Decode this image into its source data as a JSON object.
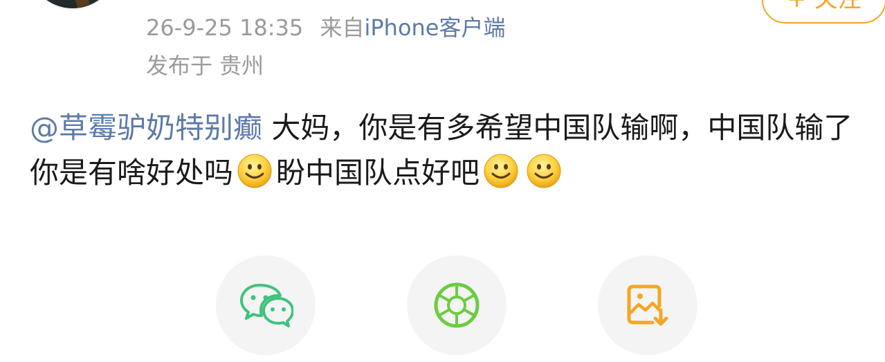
{
  "post": {
    "time": "26-9-25 18:35",
    "from_prefix": "来自",
    "source": "iPhone客户端",
    "location": "发布于 贵州",
    "follow_label": "+ 关注"
  },
  "content": {
    "mention": "@草霉驴奶特别癫",
    "text_part1": " 大妈，你是有多希望中国队输啊，中国队输了你是有啥好处吗",
    "text_part2": "盼中国队点好吧",
    "emoji_name": "smile-emoji"
  },
  "share": {
    "items": [
      {
        "name": "wechat-share-button",
        "icon": "wechat-icon",
        "color": "#3ec37c"
      },
      {
        "name": "moments-share-button",
        "icon": "moments-shutter-icon",
        "color": "#6ccc3f"
      },
      {
        "name": "save-image-button",
        "icon": "save-image-icon",
        "color": "#f5a623"
      }
    ]
  }
}
